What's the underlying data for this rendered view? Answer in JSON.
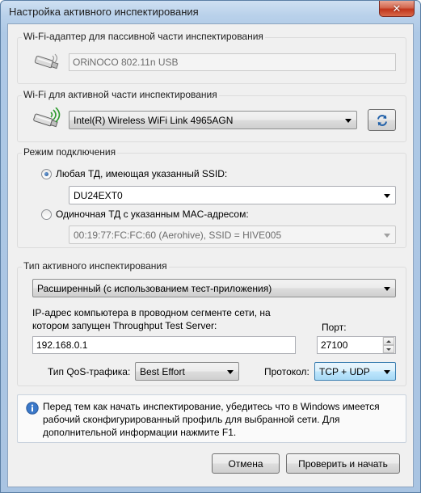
{
  "window": {
    "title": "Настройка активного инспектирования",
    "close_label": "✕"
  },
  "passive": {
    "group_title": "Wi-Fi-адаптер для пассивной части инспектирования",
    "adapter_value": "ORiNOCO 802.11n USB"
  },
  "active": {
    "group_title": "Wi-Fi для активной части инспектирования",
    "adapter_value": "Intel(R) Wireless WiFi Link 4965AGN"
  },
  "connection": {
    "group_title": "Режим подключения",
    "option_ssid_label": "Любая ТД, имеющая указанный SSID:",
    "ssid_value": "DU24EXT0",
    "option_mac_label": "Одиночная ТД с указанным MAC-адресом:",
    "mac_value": "00:19:77:FC:FC:60 (Aerohive), SSID = HIVE005",
    "selected": "ssid"
  },
  "inspection": {
    "group_title": "Тип активного инспектирования",
    "type_value": "Расширенный (с использованием тест-приложения)",
    "ip_label_line1": "IP-адрес компьютера в проводном сегменте сети, на",
    "ip_label_line2": "котором запущен Throughput Test Server:",
    "ip_value": "192.168.0.1",
    "port_label": "Порт:",
    "port_value": "27100",
    "qos_label": "Тип QoS-трафика:",
    "qos_value": "Best Effort",
    "protocol_label": "Протокол:",
    "protocol_value": "TCP + UDP"
  },
  "info": {
    "text": "Перед тем как начать инспектирование, убедитесь что в Windows имеется рабочий сконфигурированный профиль для выбранной сети. Для дополнительной информации нажмите F1."
  },
  "buttons": {
    "cancel": "Отмена",
    "start": "Проверить и начать"
  },
  "icons": [
    "usb-adapter-icon",
    "wireless-adapter-icon",
    "refresh-icon",
    "info-icon",
    "close-icon"
  ],
  "colors": {
    "title_bar": "#b9d1ea",
    "close_button": "#c1351b",
    "protocol_highlight": "#bee6fd"
  }
}
